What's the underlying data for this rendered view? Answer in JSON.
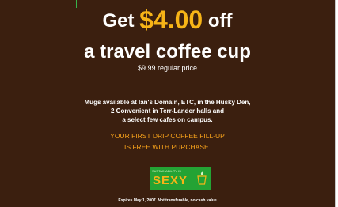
{
  "coupon": {
    "headline_prefix": "Get ",
    "headline_amount": "$4.00",
    "headline_suffix": " off",
    "subhead": "a travel coffee cup",
    "regular_price": "$9.99 regular price",
    "availability_lines": [
      "Mugs available at Ian's Domain, ETC, in the Husky Den,",
      "2 Convenient in Terr-Lander halls and",
      "a select few cafes on campus."
    ],
    "promo_lines": [
      "YOUR FIRST DRIP COFFEE FILL-UP",
      "IS FREE WITH PURCHASE."
    ],
    "logo": {
      "word": "SEXY",
      "tagline": "SUSTAINABILITY IS"
    },
    "expires": "Expires May 1, 2007. Not transferable, no cash value"
  },
  "colors": {
    "background": "#3b1f0f",
    "accent_amount": "#f7b417",
    "promo_text": "#f7a21b",
    "logo_green": "#24a334"
  }
}
